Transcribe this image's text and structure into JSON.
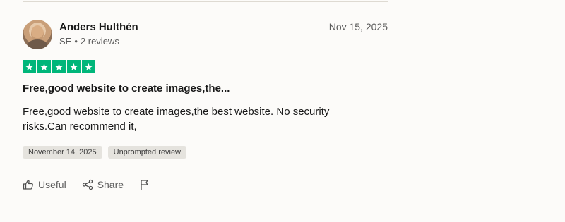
{
  "review": {
    "reviewer_name": "Anders Hulthén",
    "reviewer_country": "SE",
    "reviewer_separator": "•",
    "reviewer_reviews": "2 reviews",
    "posted_date": "Nov 15, 2025",
    "rating": 5,
    "rating_icon": "star-icon",
    "title": "Free,good website to create images,the...",
    "body": "Free,good website to create images,the best website. No security risks.Can recommend it,",
    "experience_date": "November 14, 2025",
    "review_type": "Unprompted review",
    "actions": {
      "useful_label": "Useful",
      "share_label": "Share"
    },
    "icons": {
      "useful": "thumbs-up-icon",
      "share": "share-icon",
      "report": "flag-icon"
    },
    "colors": {
      "star_green": "#00b67a",
      "text_dark": "#191919",
      "text_muted": "#5c5c5c",
      "badge_bg": "#e5e3de",
      "page_bg": "#fcfbf9"
    }
  }
}
